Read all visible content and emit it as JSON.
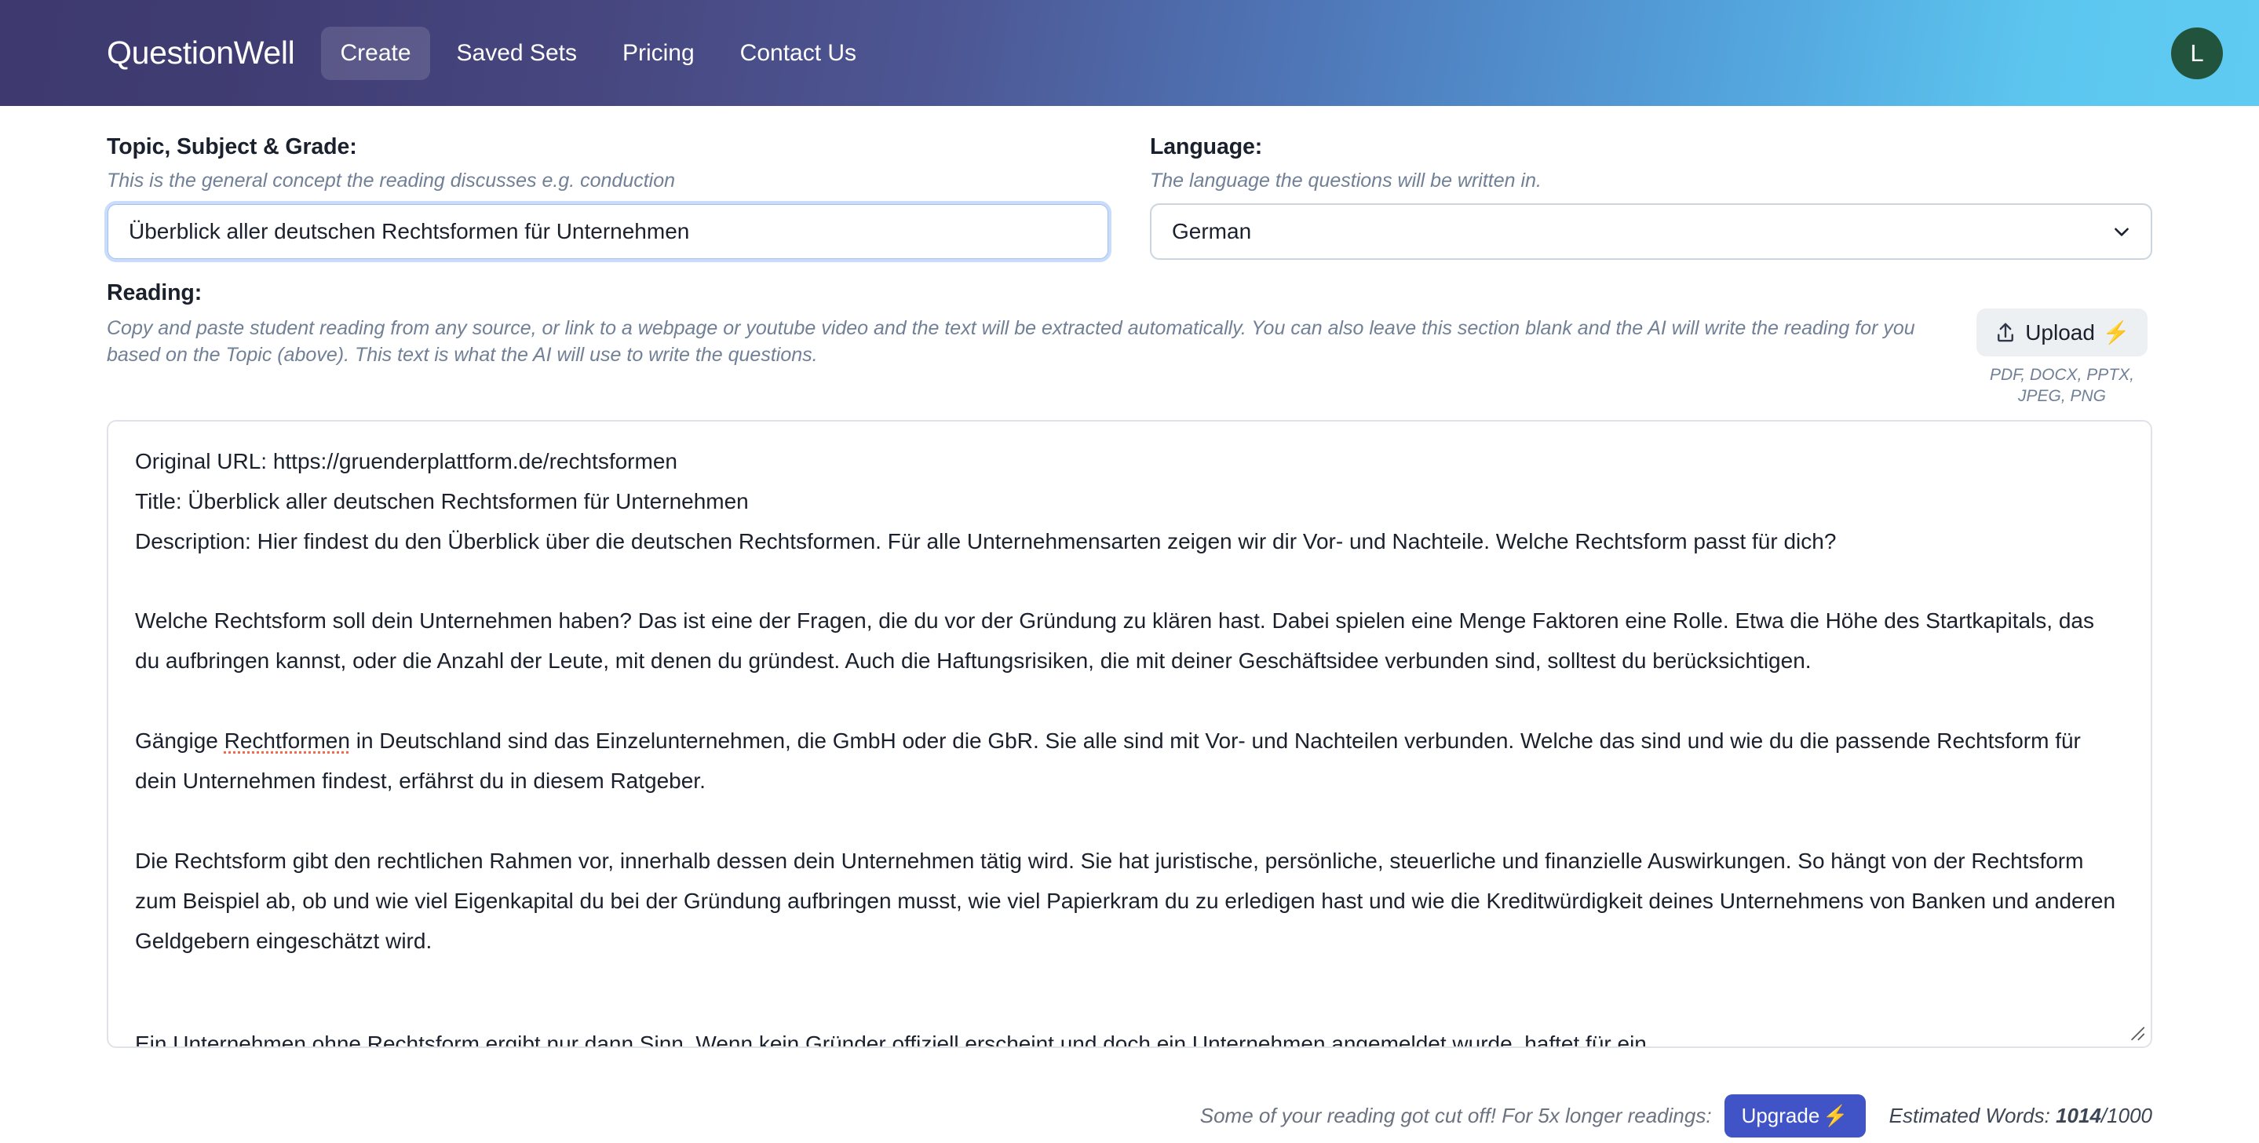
{
  "navbar": {
    "brand": "QuestionWell",
    "links": [
      {
        "label": "Create",
        "active": true
      },
      {
        "label": "Saved Sets",
        "active": false
      },
      {
        "label": "Pricing",
        "active": false
      },
      {
        "label": "Contact Us",
        "active": false
      }
    ],
    "avatar_initial": "L",
    "avatar_color": "#22543d",
    "gradient_from": "#3e3a70",
    "gradient_to": "#5fcbf2"
  },
  "topic": {
    "label": "Topic, Subject & Grade:",
    "hint": "This is the general concept the reading discusses e.g. conduction",
    "value": "Überblick aller deutschen Rechtsformen für Unternehmen",
    "placeholder": "This is the general concept the reading discusses e.g. conduction"
  },
  "language": {
    "label": "Language:",
    "hint": "The language the questions will be written in.",
    "selected": "German",
    "chevron_icon": "chevron-down-icon"
  },
  "reading": {
    "label": "Reading:",
    "hint": "Copy and paste student reading from any source, or link to a webpage or youtube video and the text will be extracted automatically. You can also leave this section blank and the AI will write the reading for you based on the Topic (above). This text is what the AI will use to write the questions.",
    "upload_label": "Upload",
    "upload_icon": "upload-icon",
    "upload_bolt": "⚡",
    "upload_types": "PDF, DOCX, PPTX, JPEG, PNG",
    "lines": [
      "Original URL: https://gruenderplattform.de/rechtsformen",
      "Title: Überblick aller deutschen Rechtsformen für Unternehmen",
      "Description: Hier findest du den Überblick über die deutschen Rechtsformen. Für alle Unternehmensarten zeigen wir dir Vor- und Nachteile. Welche Rechtsform passt für dich?"
    ],
    "para2": "Welche Rechtsform soll dein Unternehmen haben? Das ist eine der Fragen, die du vor der Gründung zu klären hast. Dabei spielen eine Menge Faktoren eine Rolle. Etwa die Höhe des Startkapitals, das du aufbringen kannst, oder die Anzahl der Leute, mit denen du gründest. Auch die Haftungsrisiken, die mit deiner Geschäftsidee verbunden sind, solltest du berücksichtigen.",
    "para3_pre": "Gängige ",
    "para3_misspelled": "Rechtformen",
    "para3_post": " in Deutschland sind das Einzelunternehmen, die GmbH oder die GbR. Sie alle sind mit Vor- und Nachteilen verbunden. Welche das sind und wie du die passende Rechtsform für dein Unternehmen findest, erfährst du in diesem Ratgeber.",
    "para4": "Die Rechtsform gibt den rechtlichen Rahmen vor, innerhalb dessen dein Unternehmen tätig wird. Sie hat juristische, persönliche, steuerliche und finanzielle Auswirkungen. So hängt von der Rechtsform zum Beispiel ab, ob und wie viel Eigenkapital du bei der Gründung aufbringen musst, wie viel Papierkram du zu erledigen hast und wie die Kreditwürdigkeit deines Unternehmens von Banken und anderen Geldgebern eingeschätzt wird.",
    "para5_clipped": "Ein Unternehmen ohne Rechtsform ergibt nur dann Sinn, Wenn kein Gründer offiziell erscheint und doch ein Unternehmen angemeldet wurde, haftet für ein",
    "resize_grip_icon": "resize-grip-icon"
  },
  "status": {
    "warning": "Some of your reading got cut off! For 5x longer readings:",
    "upgrade_label": "Upgrade",
    "upgrade_bolt": "⚡",
    "upgrade_color": "#4054c8",
    "words_prefix": "Estimated Words: ",
    "words_count": "1014",
    "words_limit": "/1000"
  }
}
